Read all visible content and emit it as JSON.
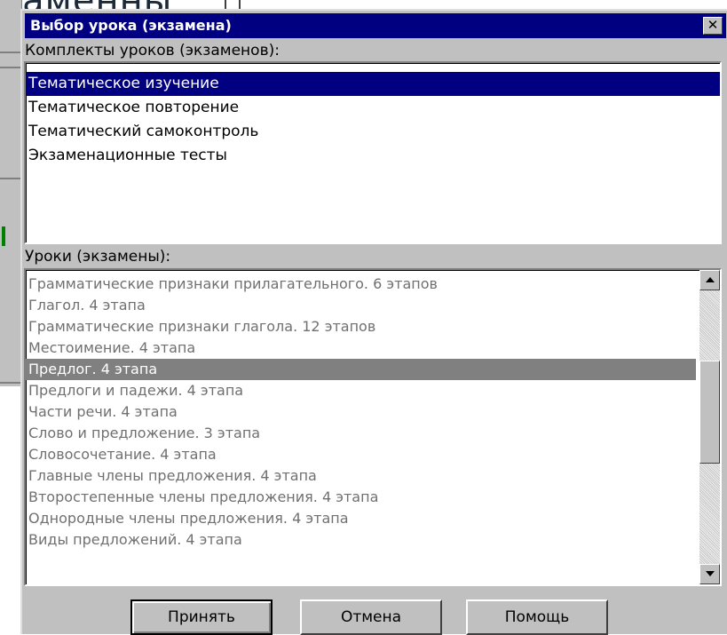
{
  "background_window": {
    "title_fragment": "каменны"
  },
  "dialog": {
    "title": "Выбор урока (экзамена)",
    "close_glyph": "✕",
    "sets_label": "Комплекты уроков (экзаменов):",
    "sets": [
      {
        "label": "Тематическое изучение",
        "selected": true
      },
      {
        "label": "Тематическое повторение",
        "selected": false
      },
      {
        "label": "Тематический самоконтроль",
        "selected": false
      },
      {
        "label": "Экзаменационные тесты",
        "selected": false
      }
    ],
    "lessons_label": "Уроки (экзамены):",
    "lessons": [
      {
        "label": "Грамматические признаки прилагательного. 6 этапов",
        "selected": false
      },
      {
        "label": "Глагол. 4 этапа",
        "selected": false
      },
      {
        "label": "Грамматические признаки глагола. 12 этапов",
        "selected": false
      },
      {
        "label": "Местоимение. 4 этапа",
        "selected": false
      },
      {
        "label": "Предлог. 4 этапа",
        "selected": true
      },
      {
        "label": "Предлоги и падежи. 4 этапа",
        "selected": false
      },
      {
        "label": "Части речи. 4 этапа",
        "selected": false
      },
      {
        "label": "Слово и предложение. 3 этапа",
        "selected": false
      },
      {
        "label": "Словосочетание. 4 этапа",
        "selected": false
      },
      {
        "label": "Главные члены предложения. 4 этапа",
        "selected": false
      },
      {
        "label": "Второстепенные члены предложения. 4 этапа",
        "selected": false
      },
      {
        "label": "Однородные члены предложения. 4 этапа",
        "selected": false
      },
      {
        "label": "Виды предложений. 4 этапа",
        "selected": false
      }
    ],
    "buttons": {
      "accept": "Принять",
      "cancel": "Отмена",
      "help": "Помощь"
    }
  },
  "colors": {
    "titlebar": "#000080",
    "selection_active": "#000080",
    "selection_inactive": "#808080",
    "dialog_face": "#c0c0c0"
  }
}
